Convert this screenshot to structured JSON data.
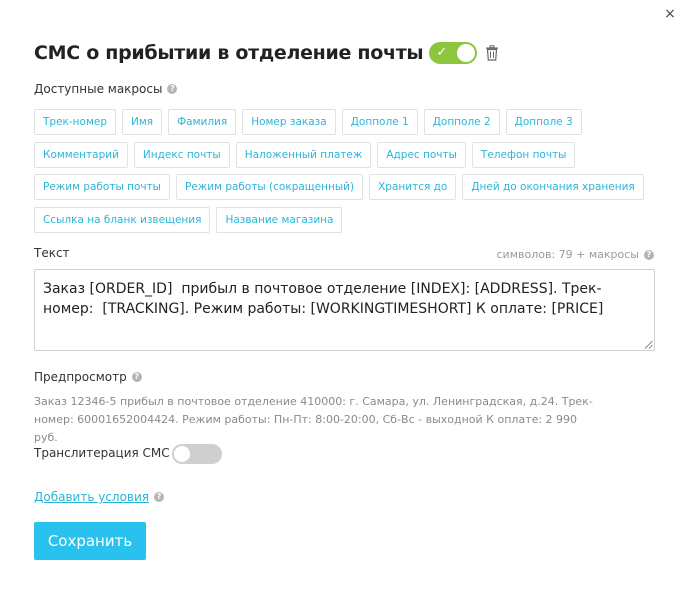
{
  "dialog": {
    "close_glyph": "×",
    "title": "СМС о прибытии в отделение почты",
    "enabled": true,
    "enabled_check": "✓"
  },
  "macros": {
    "label": "Доступные макросы",
    "rows": [
      [
        "Трек-номер",
        "Имя",
        "Фамилия",
        "Номер заказа",
        "Допполе 1",
        "Допполе 2",
        "Допполе 3"
      ],
      [
        "Комментарий",
        "Индекс почты",
        "Наложенный платеж",
        "Адрес почты",
        "Телефон почты"
      ],
      [
        "Режим работы почты",
        "Режим работы (сокращенный)",
        "Хранится до",
        "Дней до окончания хранения"
      ],
      [
        "Ссылка на бланк извещения",
        "Название магазина"
      ]
    ]
  },
  "text": {
    "label": "Текст",
    "counter": "символов: 79 + макросы",
    "value": "Заказ [ORDER_ID]  прибыл в почтовое отделение [INDEX]: [ADDRESS]. Трек-номер:  [TRACKING]. Режим работы: [WORKINGTIMESHORT] К оплате: [PRICE]"
  },
  "preview": {
    "label": "Предпросмотр",
    "text": "Заказ 12346-5 прибыл в почтовое отделение 410000: г. Самара, ул. Ленинградская, д.24. Трек-номер: 60001652004424. Режим работы: Пн-Пт: 8:00-20:00, Сб-Вс - выходной К оплате: 2 990 руб."
  },
  "translit": {
    "label": "Транслитерация СМС",
    "enabled": false
  },
  "add_condition": {
    "label": "Добавить условия"
  },
  "save_button": {
    "label": "Сохранить"
  },
  "help_glyph": "?",
  "colors": {
    "accent": "#29c2ef",
    "link": "#29b6d8",
    "toggle_on": "#8cc63f",
    "toggle_off": "#cfcfcf"
  },
  "icons": {
    "close": "close-icon",
    "trash": "trash-icon",
    "help": "help-icon",
    "check": "check-icon",
    "resize": "resize-grip-icon"
  }
}
